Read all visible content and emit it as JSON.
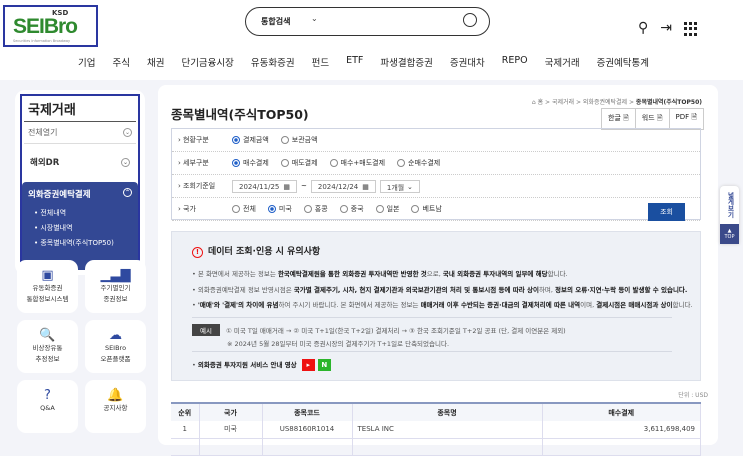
{
  "header": {
    "logo": "SEIBro",
    "logo_ksd": "KSD",
    "logo_sub": "Securities Information Broadway",
    "search_scope": "통합검색"
  },
  "nav": [
    "기업",
    "주식",
    "채권",
    "단기금융시장",
    "유동화증권",
    "펀드",
    "ETF",
    "파생결합증권",
    "증권대차",
    "REPO",
    "국제거래",
    "증권예탁통계"
  ],
  "sidebar": {
    "title": "국제거래",
    "expand_all": "전체열기",
    "items": [
      {
        "label": "해외DR"
      },
      {
        "label": "외화증권예탁결제",
        "children": [
          "전체내역",
          "시장별내역",
          "종목별내역(주식TOP50)"
        ]
      }
    ]
  },
  "tiles": [
    [
      "유동화증권",
      "통합정보시스템"
    ],
    [
      "주기별인기",
      "종권정보"
    ],
    [
      "비상장유통",
      "추정정보"
    ],
    [
      "SEIBro",
      "오픈플랫폼"
    ],
    [
      "Q&A",
      ""
    ],
    [
      "공지사항",
      ""
    ]
  ],
  "page": {
    "title": "종목별내역(주식TOP50)",
    "breadcrumb": [
      "홈",
      "국제거래",
      "외화증권예탁결제",
      "종목별내역(주식TOP50)"
    ],
    "exports": [
      "한글",
      "워드",
      "PDF"
    ]
  },
  "form": {
    "status_label": "현황구분",
    "status_opts": [
      "결제금액",
      "보관금액"
    ],
    "detail_label": "세부구분",
    "detail_opts": [
      "매수결제",
      "매도결제",
      "매수+매도결제",
      "순매수결제"
    ],
    "date_label": "조회기준일",
    "date_from": "2024/11/25",
    "date_to": "2024/12/24",
    "period": "1개월",
    "country_label": "국가",
    "country_opts": [
      "전체",
      "미국",
      "홍콩",
      "중국",
      "일본",
      "베트남"
    ],
    "search_btn": "조회"
  },
  "notice": {
    "title": "데이터 조회·인용 시 유의사항",
    "l1a": "본 화면에서 제공하는 정보는 ",
    "l1b": "한국예탁결제원을 통한 외화증권 투자내역만 반영한 것",
    "l1c": "으로, ",
    "l1d": "국내 외화증권 투자내역의 일부에 해당",
    "l1e": "합니다.",
    "l2a": "외화증권예탁결제 정보 반영시점은 ",
    "l2b": "국가별 결제주기, 시차, 현지 결제기관과 외국보관기관의 처리 및 통보시점 등에 따라 상이",
    "l2c": "하며, ",
    "l2d": "정보의 오류·지연·누락 등이 발생할 수 있습니다.",
    "l3a": "'매매'와 '결제'의 차이에 유념",
    "l3b": "하여 주시기 바랍니다. 본 화면에서 제공하는 정보는 ",
    "l3c": "매매거래 이후 수반되는 증권·대금의 결제처리에 따른 내역",
    "l3d": "이며, ",
    "l3e": "결제시점은 매매시점과 상이",
    "l3f": "합니다.",
    "example_tag": "예시",
    "example": "① 미국 T일 매매거래 → ② 미국 T+1일(한국 T+2일) 결제처리 → ③ 한국 조회기준일 T+2일 공표 (단, 결제 이연분은 제외)",
    "example_note": "※ 2024년 5월 28일부터 미국 증권시장의 결제주기가 T+1일로 단축되었습니다.",
    "video": "외화증권 투자지원 서비스 안내 영상",
    "video_n": "N"
  },
  "table": {
    "unit": "단위 : USD",
    "headers": [
      "순위",
      "국가",
      "종목코드",
      "종목명",
      "매수결제"
    ],
    "rows": [
      [
        "1",
        "미국",
        "US88160R1014",
        "TESLA INC",
        "3,611,698,409"
      ]
    ]
  },
  "float": {
    "wide": "넓게보기",
    "top": "TOP"
  },
  "colors": {
    "accent": "#334894",
    "button": "#1a4fa0"
  }
}
